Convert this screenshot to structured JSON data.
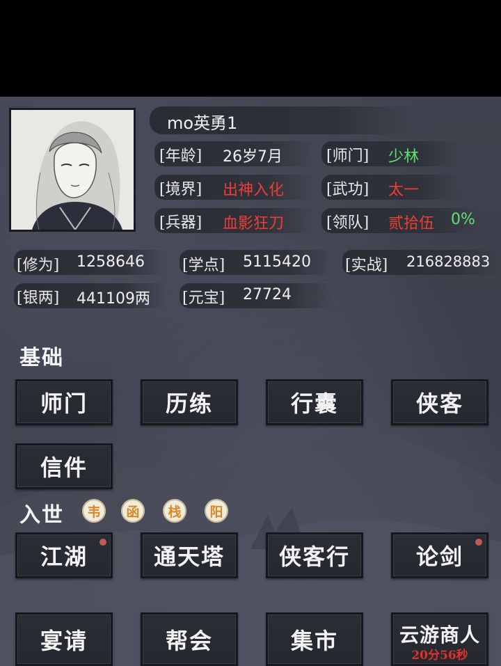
{
  "profile": {
    "name": "mo英勇1",
    "age_label": "[年龄]",
    "age_value": "26岁7月",
    "sect_label": "[师门]",
    "sect_value": "少林",
    "realm_label": "[境界]",
    "realm_value": "出神入化",
    "skill_label": "[武功]",
    "skill_value": "太一",
    "weapon_label": "[兵器]",
    "weapon_value": "血影狂刀",
    "team_label": "[领队]",
    "team_value": "贰拾伍",
    "team_percent": "0%"
  },
  "stats": {
    "cultivation_label": "[修为]",
    "cultivation_value": "1258646",
    "study_label": "[学点]",
    "study_value": "5115420",
    "combat_label": "[实战]",
    "combat_value": "216828883",
    "silver_label": "[银两]",
    "silver_value": "441109两",
    "ingot_label": "[元宝]",
    "ingot_value": "27724"
  },
  "basic": {
    "title": "基础",
    "buttons": [
      "师门",
      "历练",
      "行囊",
      "侠客",
      "信件"
    ]
  },
  "world": {
    "title": "入世",
    "seals": [
      "韦",
      "函",
      "栈",
      "阳"
    ],
    "buttons": [
      "江湖",
      "通天塔",
      "侠客行",
      "论剑",
      "宴请",
      "帮会",
      "集市",
      "云游商人"
    ],
    "merchant_timer": "20分56秒"
  },
  "colors": {
    "green": "#5fe070",
    "red": "#ef3d36",
    "panel": "#3e414d"
  }
}
